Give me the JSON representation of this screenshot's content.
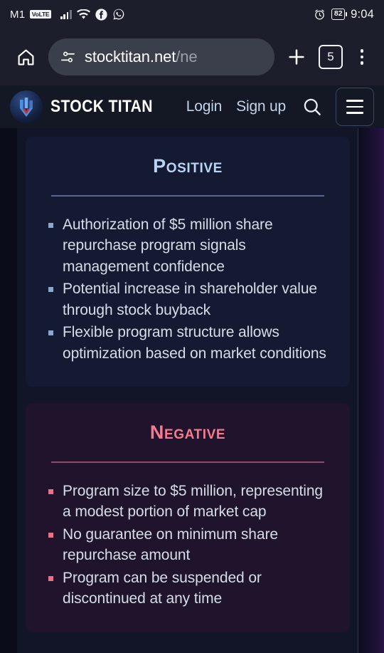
{
  "status_bar": {
    "carrier": "M1",
    "network_badge": "VoLTE",
    "icons": [
      "signal-bars-icon",
      "wifi-icon",
      "facebook-icon",
      "whatsapp-icon",
      "alarm-clock-icon"
    ],
    "battery_percent": "82",
    "time": "9:04"
  },
  "browser_bar": {
    "home_icon": "home-icon",
    "page_info_icon": "page-settings-icon",
    "url_visible": "stocktitan.net",
    "url_truncated": "/ne",
    "new_tab_icon": "plus-icon",
    "tab_count": "5",
    "overflow_icon": "three-dots-icon"
  },
  "site_header": {
    "logo_icon": "stock-titan-logo-icon",
    "brand": "STOCK TITAN",
    "login_label": "Login",
    "signup_label": "Sign up",
    "search_icon": "search-icon",
    "menu_icon": "hamburger-menu-icon"
  },
  "colors": {
    "positive_accent": "#b9d5f5",
    "negative_accent": "#f9798f",
    "positive_card_bg": "#151a33",
    "negative_card_bg": "#1f142b",
    "page_bg": "#121528"
  },
  "sections": [
    {
      "title": "Positive",
      "bullets": [
        "Authorization of $5 million share repurchase program signals management confidence",
        "Potential increase in shareholder value through stock buyback",
        "Flexible program structure allows optimization based on market conditions"
      ]
    },
    {
      "title": "Negative",
      "bullets": [
        "Program size to $5 million, representing a modest portion of market cap",
        "No guarantee on minimum share repurchase amount",
        "Program can be suspended or discontinued at any time"
      ]
    }
  ]
}
